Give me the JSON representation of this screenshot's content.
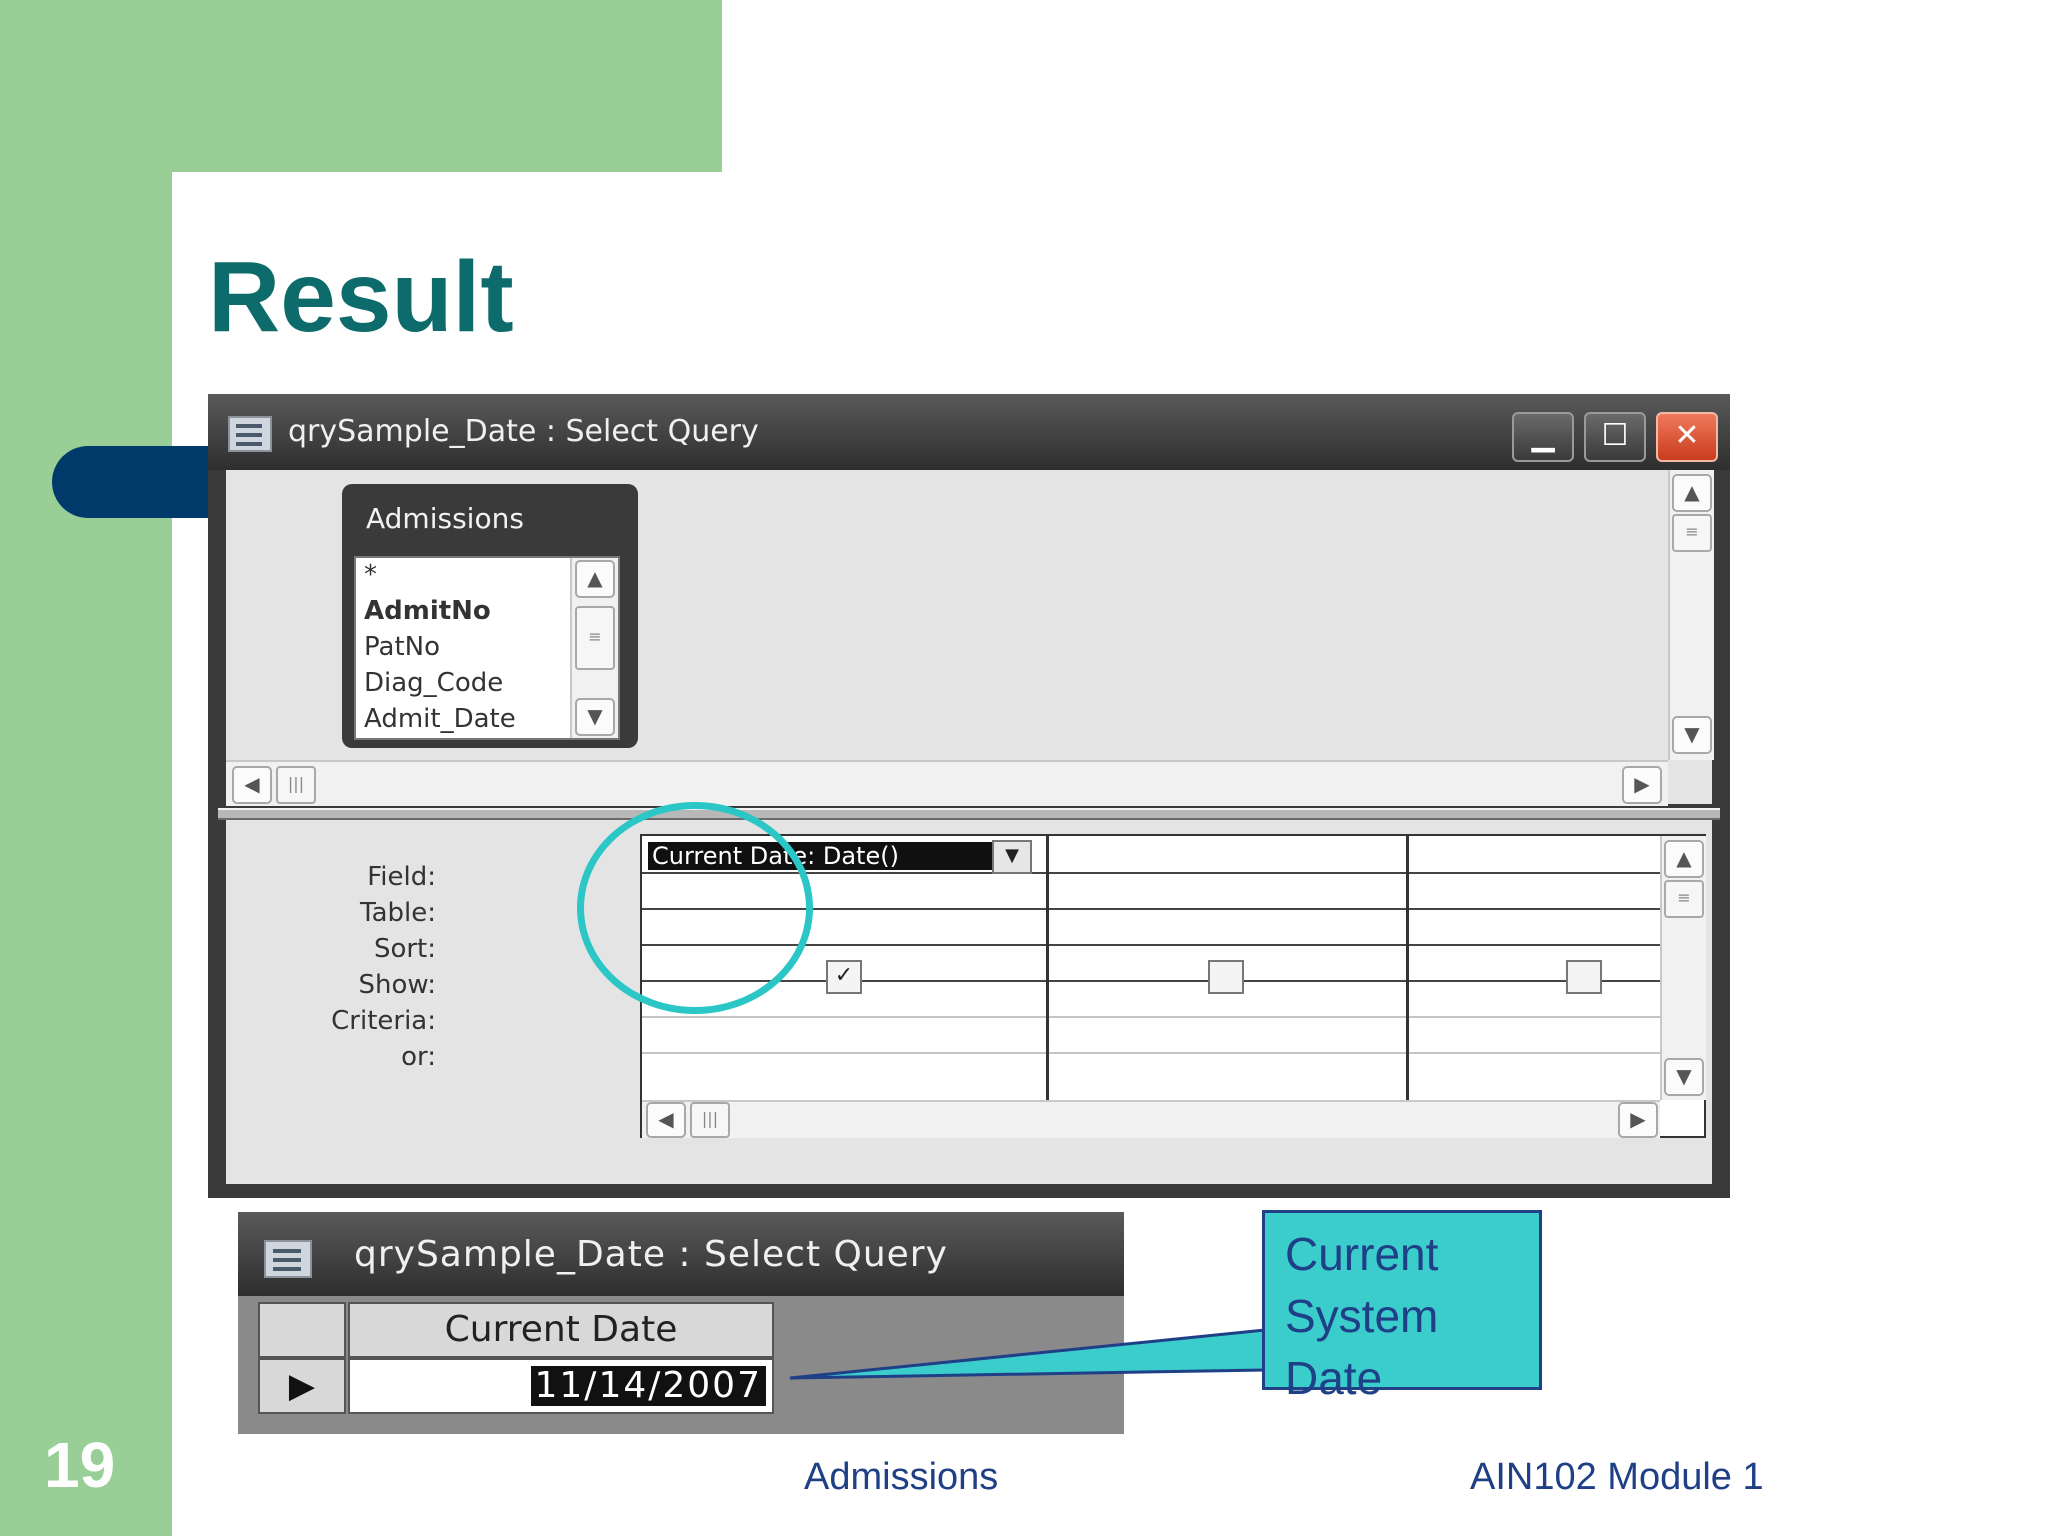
{
  "slide": {
    "title": "Result",
    "number": "19",
    "footer_center": "Admissions",
    "footer_right": "AIN102  Module 1"
  },
  "design_window": {
    "title": "qrySample_Date : Select Query",
    "minimize_glyph": "▁",
    "maximize_glyph": "☐",
    "close_glyph": "✕",
    "table_box": {
      "name": "Admissions",
      "fields": [
        "*",
        "AdmitNo",
        "PatNo",
        "Diag_Code",
        "Admit_Date"
      ],
      "primary_key_field": "AdmitNo"
    },
    "grid_row_labels": [
      "Field:",
      "Table:",
      "Sort:",
      "Show:",
      "Criteria:",
      "or:"
    ],
    "columns": [
      {
        "field": "Current Date: Date()",
        "show": true
      },
      {
        "field": "",
        "show": false
      },
      {
        "field": "",
        "show": false
      }
    ],
    "icons": {
      "up": "▲",
      "down": "▼",
      "left": "◀",
      "right": "▶",
      "thumb": "≡",
      "hthumb": "|||",
      "dropdown": "▼",
      "check": "✓"
    }
  },
  "result_window": {
    "title": "qrySample_Date : Select Query",
    "column_header": "Current Date",
    "record_marker": "▶",
    "value": "11/14/2007"
  },
  "callout": {
    "lines": [
      "Current",
      "System",
      "Date"
    ]
  },
  "colors": {
    "green_background": "#99ce97",
    "title_teal": "#0d6b6b",
    "navy_tab": "#003a6b",
    "callout_fill": "#3bcccc",
    "highlight_circle": "#2bc6c6",
    "footer_text": "#1f3f86"
  }
}
